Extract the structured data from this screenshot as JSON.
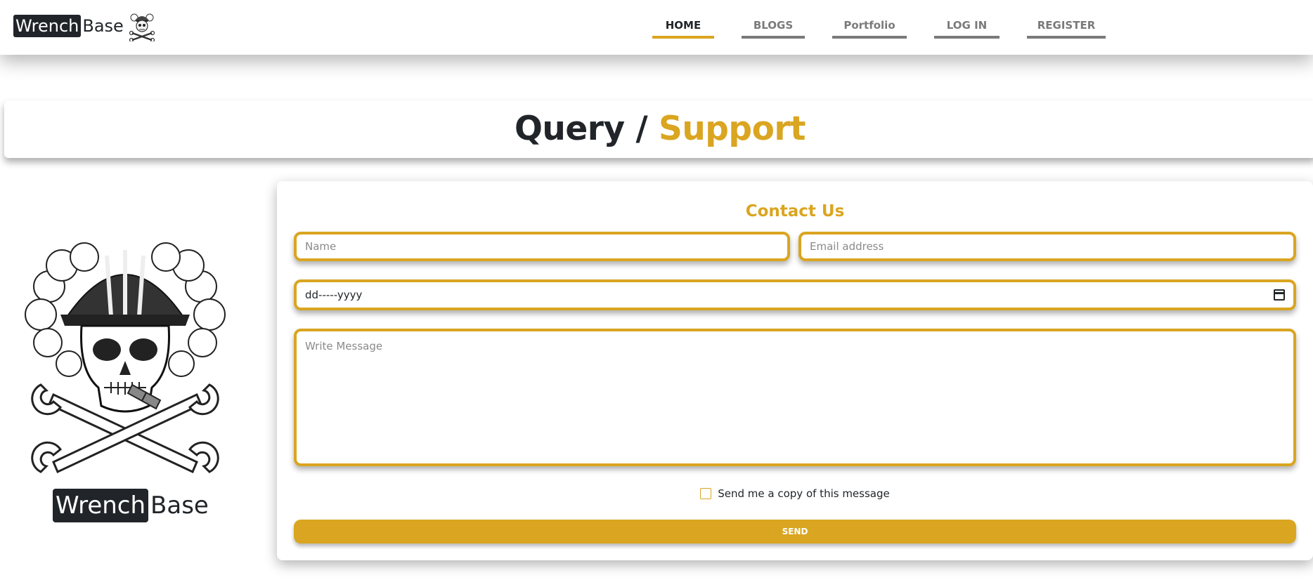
{
  "navbar": {
    "brand_dark": "Wrench",
    "brand_light": "Base",
    "brand_logo_icon": "skull-hardhat-icon",
    "links": [
      {
        "label": "HOME",
        "active": true
      },
      {
        "label": "BLOGS",
        "active": false
      },
      {
        "label": "Portfolio",
        "active": false
      },
      {
        "label": "LOG IN",
        "active": false
      },
      {
        "label": "REGISTER",
        "active": false
      }
    ]
  },
  "header": {
    "title_dark": "Query / ",
    "title_gold": "Support"
  },
  "left_panel": {
    "art_icon": "skull-crossed-wrenches-icon",
    "brand_dark": "Wrench",
    "brand_light": "Base"
  },
  "contact": {
    "title": "Contact Us",
    "name_placeholder": "Name",
    "email_placeholder": "Email address",
    "date_value": "dd-----yyyy",
    "date_icon": "calendar-icon",
    "message_placeholder": "Write Message",
    "copy_label": "Send me a copy of this message",
    "copy_checked": false,
    "send_label": "SEND"
  },
  "colors": {
    "accent": "#daa520",
    "dark": "#212529",
    "muted": "#7a7a7a"
  }
}
